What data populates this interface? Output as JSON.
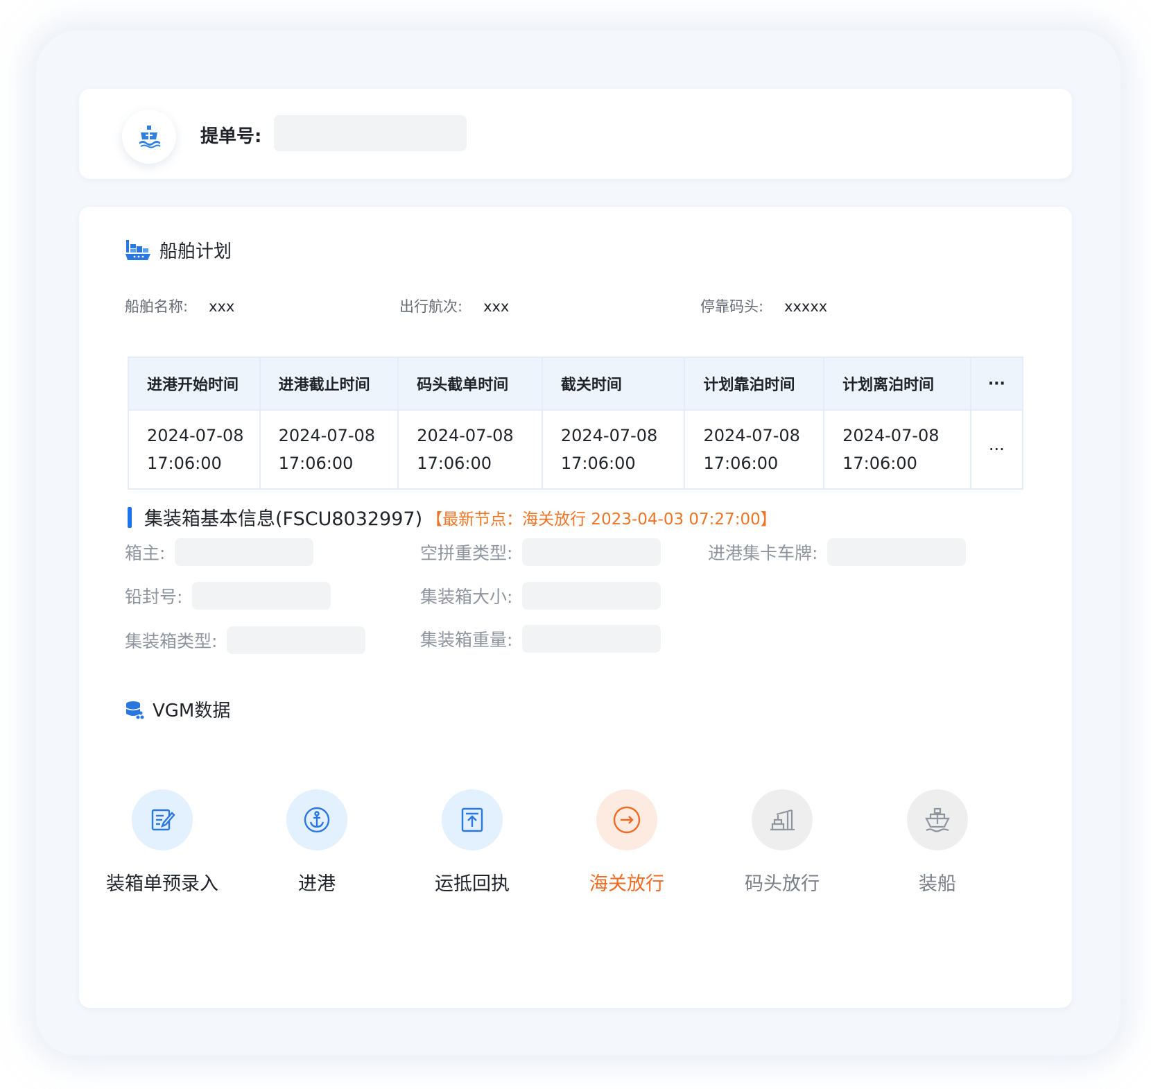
{
  "bill": {
    "label": "提单号:",
    "value": "",
    "placeholder": ""
  },
  "ship_plan": {
    "title": "船舶计划",
    "fields": [
      {
        "label": "船舶名称:",
        "value": "xxx"
      },
      {
        "label": "出行航次:",
        "value": "xxx"
      },
      {
        "label": "停靠码头:",
        "value": "xxxxx"
      }
    ],
    "table": {
      "headers": [
        "进港开始时间",
        "进港截止时间",
        "码头截单时间",
        "截关时间",
        "计划靠泊时间",
        "计划离泊时间",
        "···"
      ],
      "row": [
        {
          "date": "2024-07-08",
          "time": "17:06:00"
        },
        {
          "date": "2024-07-08",
          "time": "17:06:00"
        },
        {
          "date": "2024-07-08",
          "time": "17:06:00"
        },
        {
          "date": "2024-07-08",
          "time": "17:06:00"
        },
        {
          "date": "2024-07-08",
          "time": "17:06:00"
        },
        {
          "date": "2024-07-08",
          "time": "17:06:00"
        }
      ],
      "more": "···"
    }
  },
  "container": {
    "title": "集装箱基本信息(FSCU8032997)",
    "latest_node": "【最新节点：海关放行 2023-04-03 07:27:00】",
    "fields": {
      "owner": "箱主:",
      "empty_type": "空拼重类型:",
      "truck_plate": "进港集卡车牌:",
      "seal_no": "铅封号:",
      "size": "集装箱大小:",
      "type": "集装箱类型:",
      "weight": "集装箱重量:"
    }
  },
  "vgm": {
    "title": "VGM数据"
  },
  "steps": [
    {
      "label": "装箱单预录入",
      "status": "done",
      "icon": "edit-document-icon"
    },
    {
      "label": "进港",
      "status": "done",
      "icon": "anchor-icon"
    },
    {
      "label": "运抵回执",
      "status": "done",
      "icon": "upload-receipt-icon"
    },
    {
      "label": "海关放行",
      "status": "current",
      "icon": "arrow-right-circle-icon"
    },
    {
      "label": "码头放行",
      "status": "pending",
      "icon": "crane-icon"
    },
    {
      "label": "装船",
      "status": "pending",
      "icon": "ship-icon"
    }
  ],
  "colors": {
    "primary": "#1e73e8",
    "accent": "#f06a22",
    "muted": "#8f959e"
  }
}
